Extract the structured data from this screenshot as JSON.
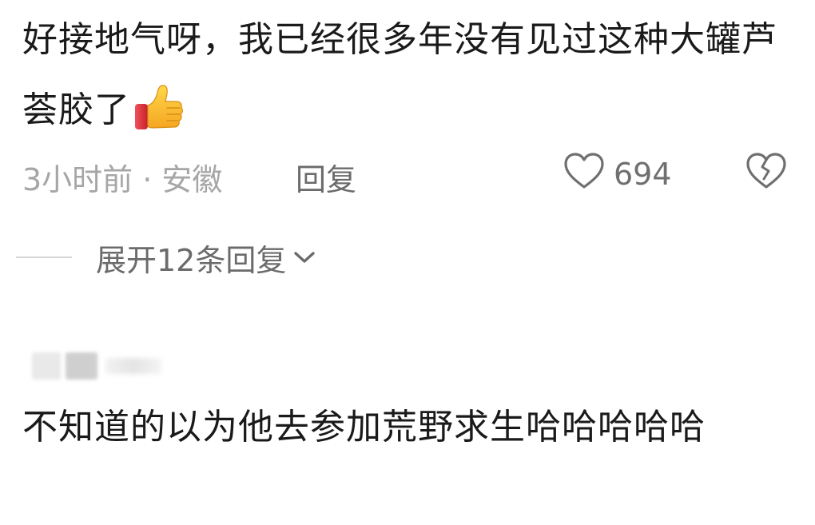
{
  "comment1": {
    "text": "好接地气呀，我已经很多年没有见过这种大罐芦荟胶了",
    "emoji_icon": "thumbs-up-emoji",
    "time_location": "3小时前 · 安徽",
    "reply_label": "回复",
    "like_count": "694",
    "like_icon": "heart-outline-icon",
    "dislike_icon": "broken-heart-icon"
  },
  "expand": {
    "label": "展开12条回复",
    "icon": "chevron-down-icon"
  },
  "comment2": {
    "text": "不知道的以为他去参加荒野求生哈哈哈哈哈"
  },
  "colors": {
    "primary_text": "#1a1a1a",
    "secondary_text": "#a6a6a6",
    "action_text": "#6b6b6b",
    "icon_stroke": "#6f6f6f",
    "emoji_yellow": "#fcc21b",
    "emoji_red": "#e53b3b"
  }
}
